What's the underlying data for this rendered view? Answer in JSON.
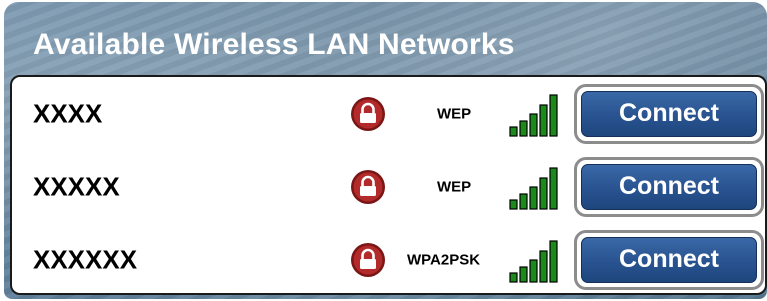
{
  "title": "Available Wireless LAN Networks",
  "colors": {
    "accent": "#2a5592",
    "lock": "#8c1c1c",
    "signal": "#1b8a1b"
  },
  "networks": [
    {
      "ssid": "XXXX",
      "security": "WEP",
      "signal_bars": 5,
      "action_label": "Connect",
      "lock_icon": "lock-icon"
    },
    {
      "ssid": "XXXXX",
      "security": "WEP",
      "signal_bars": 5,
      "action_label": "Connect",
      "lock_icon": "lock-icon"
    },
    {
      "ssid": "XXXXXX",
      "security": "WPA2PSK",
      "signal_bars": 5,
      "action_label": "Connect",
      "lock_icon": "lock-icon"
    }
  ]
}
